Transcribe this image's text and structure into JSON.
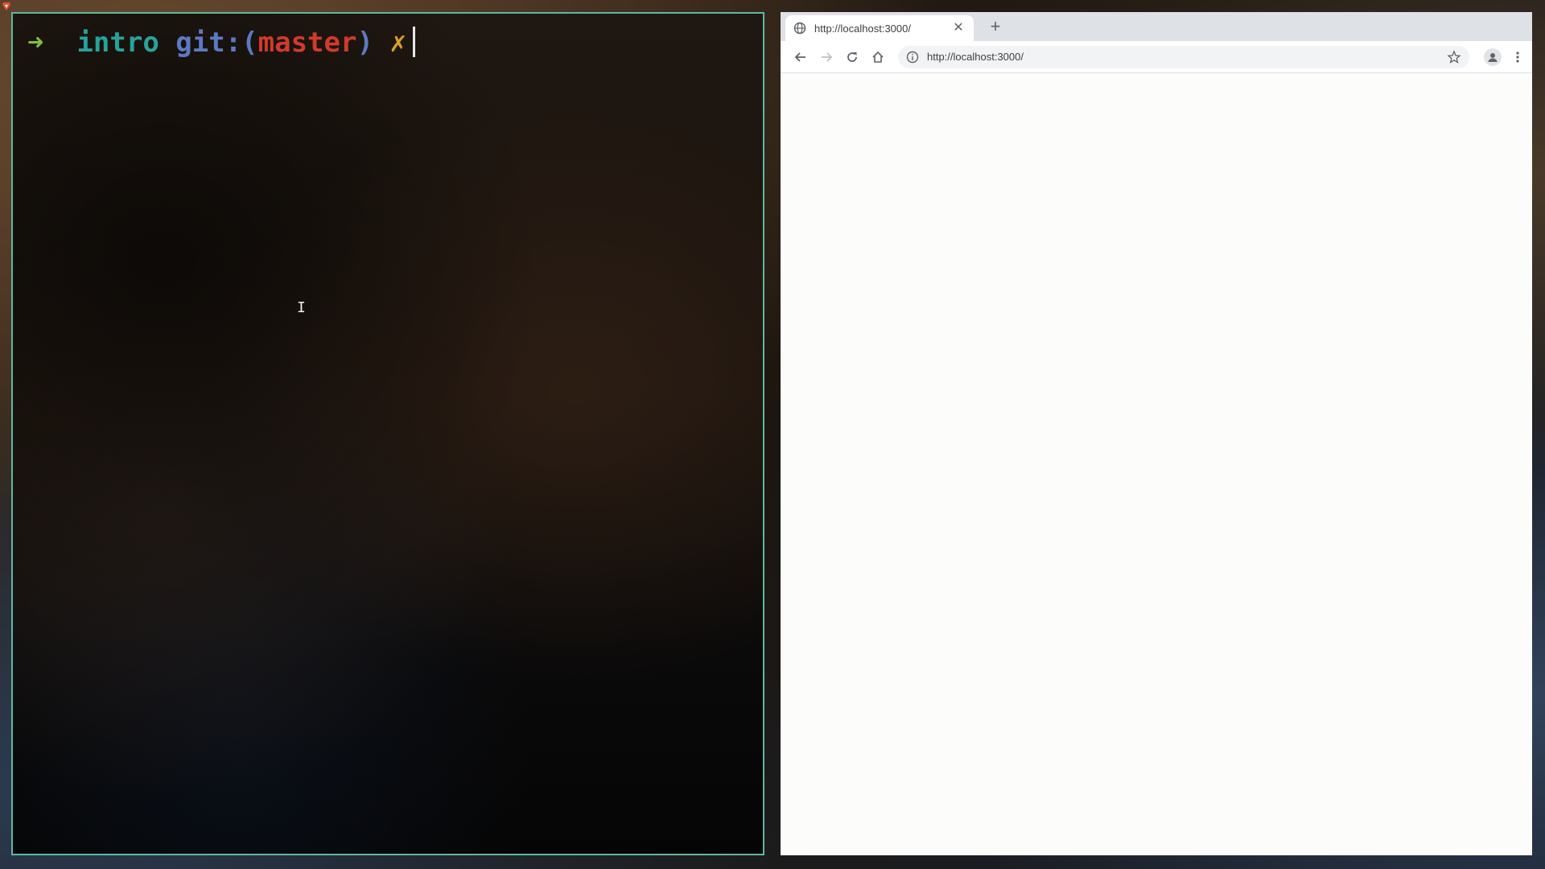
{
  "terminal": {
    "prompt": {
      "arrow": "➜",
      "dir": "intro",
      "git_prefix": "git:(",
      "branch": "master",
      "git_suffix": ")",
      "dirty_mark": "✗"
    },
    "mouse_cursor": "I"
  },
  "browser": {
    "tab": {
      "title": "http://localhost:3000/",
      "close_glyph": "✕",
      "icon": "globe-icon"
    },
    "new_tab_glyph": "+",
    "toolbar": {
      "icons": [
        "back-arrow-icon",
        "forward-arrow-icon",
        "reload-icon",
        "home-icon",
        "info-icon",
        "star-icon",
        "profile-icon",
        "menu-dots-icon"
      ]
    },
    "omnibox": {
      "url": "http://localhost:3000/"
    }
  },
  "colors": {
    "terminal_border": "#5fb8a2",
    "prompt_arrow": "#7fbf3f",
    "prompt_dir": "#27a39a",
    "prompt_git": "#5d79c2",
    "prompt_branch": "#d13a2c",
    "prompt_dirty": "#d6a12a",
    "browser_bg": "#fcfdfa",
    "tabstrip_bg": "#dee1e6"
  }
}
